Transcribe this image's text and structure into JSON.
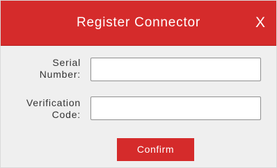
{
  "dialog": {
    "title": "Register Connector",
    "close_label": "X",
    "header_color": "#d52b2b",
    "fields": [
      {
        "label_line1": "Serial",
        "label_line2": "Number:",
        "value": "",
        "placeholder": ""
      },
      {
        "label_line1": "Verification",
        "label_line2": "Code:",
        "value": "",
        "placeholder": ""
      }
    ],
    "confirm_label": "Confirm"
  }
}
